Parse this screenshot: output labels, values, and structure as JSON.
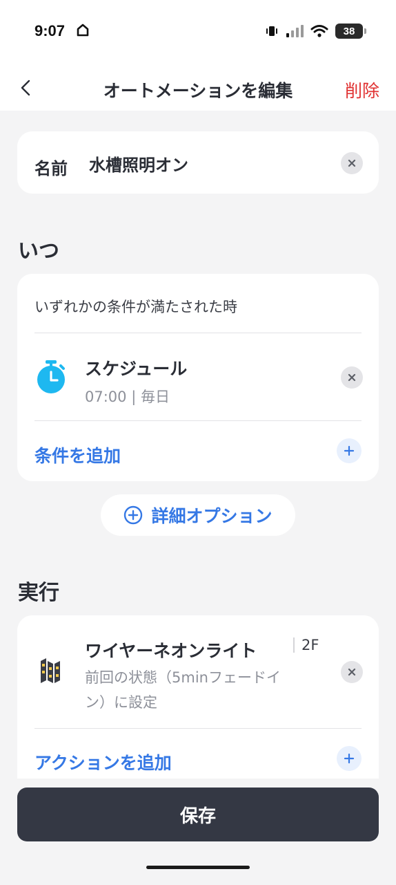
{
  "status_bar": {
    "time": "9:07",
    "battery": "38"
  },
  "nav": {
    "title": "オートメーションを編集",
    "delete_label": "削除"
  },
  "name_field": {
    "label": "名前",
    "value": "水槽照明オン"
  },
  "when_section": {
    "title": "いつ",
    "condition_caption": "いずれかの条件が満たされた時",
    "conditions": [
      {
        "title": "スケジュール",
        "subtitle": "07:00 | 毎日",
        "icon": "timer-icon",
        "icon_color": "#1eb8f0"
      }
    ],
    "add_condition_label": "条件を追加"
  },
  "detail_options_label": "詳細オプション",
  "action_section": {
    "title": "実行",
    "actions": [
      {
        "title": "ワイヤーネオンライト",
        "room": "2F",
        "subtitle_line1": "前回の状態（5minフェードイ",
        "subtitle_line2": "ン）に設定",
        "icon": "neon-light-icon"
      }
    ],
    "add_action_label": "アクションを追加"
  },
  "save_label": "保存",
  "colors": {
    "accent": "#3578e5",
    "danger": "#e03131",
    "save_button": "#343844",
    "background": "#f4f4f5"
  }
}
